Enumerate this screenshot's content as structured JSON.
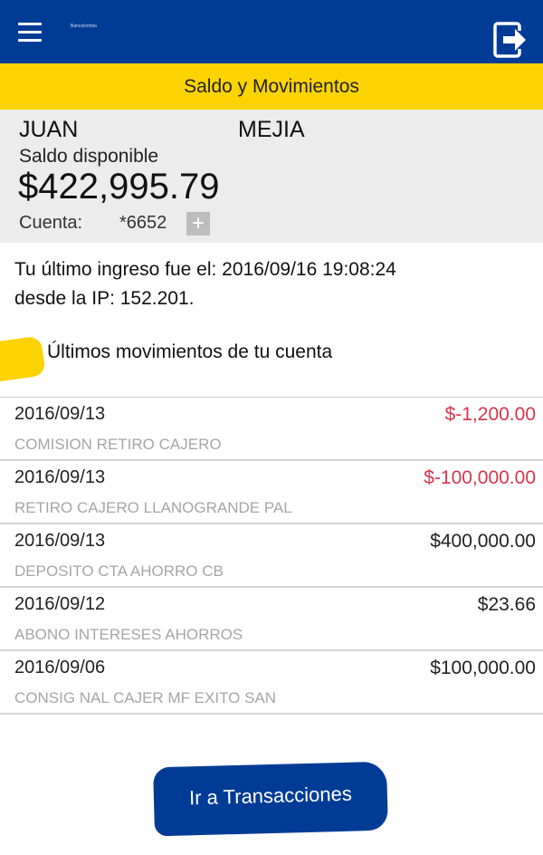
{
  "header": {
    "logo_text": "Bancolombia",
    "menu_icon": "hamburger-menu-icon",
    "logout_icon": "logout-icon"
  },
  "page_title": "Saldo y Movimientos",
  "account": {
    "first_name": "JUAN",
    "last_name": "MEJIA",
    "balance_label": "Saldo disponible",
    "balance": "$422,995.79",
    "account_label": "Cuenta:",
    "account_number": "*6652",
    "plus_label": "+"
  },
  "last_login": {
    "line1": "Tu último ingreso fue el: 2016/09/16 19:08:24",
    "line2": "desde la IP: 152.201."
  },
  "movements_title": "Últimos movimientos de tu cuenta",
  "movements": [
    {
      "date": "2016/09/13",
      "amount": "$-1,200.00",
      "description": "COMISION RETIRO CAJERO",
      "type": "negative"
    },
    {
      "date": "2016/09/13",
      "amount": "$-100,000.00",
      "description": "RETIRO CAJERO LLANOGRANDE PAL",
      "type": "negative"
    },
    {
      "date": "2016/09/13",
      "amount": "$400,000.00",
      "description": "DEPOSITO CTA AHORRO CB",
      "type": "positive"
    },
    {
      "date": "2016/09/12",
      "amount": "$23.66",
      "description": "ABONO INTERESES AHORROS",
      "type": "positive"
    },
    {
      "date": "2016/09/06",
      "amount": "$100,000.00",
      "description": "CONSIG NAL CAJER MF EXITO SAN",
      "type": "positive"
    }
  ],
  "cta_label": "Ir a Transacciones",
  "colors": {
    "brand_blue": "#003c96",
    "brand_yellow": "#fbd300",
    "negative_red": "#d9344b",
    "panel_gray": "#ececec"
  }
}
